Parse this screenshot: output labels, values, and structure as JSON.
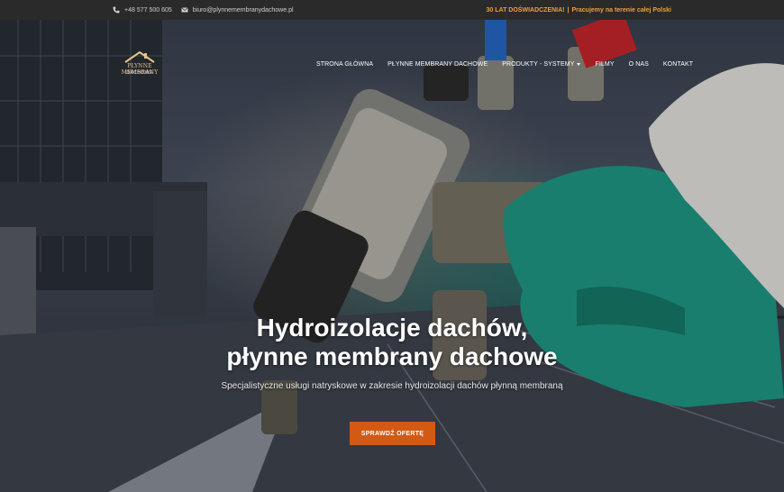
{
  "topbar": {
    "phone": "+48 577 500 605",
    "email": "biuro@plynnemembranydachowe.pl",
    "promo_highlight": "30 LAT DOŚWIADCZENIA!",
    "promo_sep": "|",
    "promo_rest": "Pracujemy na terenie całej Polski"
  },
  "logo": {
    "line1": "PŁYNNE MEMBRANY",
    "line2": "DACHOWE"
  },
  "nav": {
    "items": [
      {
        "label": "STRONA GŁÓWNA"
      },
      {
        "label": "PŁYNNE MEMBRANY DACHOWE"
      },
      {
        "label": "PRODUKTY - SYSTEMY"
      },
      {
        "label": "FILMY"
      },
      {
        "label": "O NAS"
      },
      {
        "label": "KONTAKT"
      }
    ]
  },
  "hero": {
    "title_line1": "Hydroizolacje dachów,",
    "title_line2": "płynne membrany dachowe",
    "subtitle": "Specjalistyczne usługi natryskowe w zakresie hydroizolacji dachów płynną membraną",
    "cta_label": "SPRAWDŹ OFERTĘ"
  },
  "colors": {
    "accent": "#e8a23a",
    "cta": "#d35a14",
    "topbar_bg": "#2a2a2a",
    "glove": "#1f9a86"
  },
  "icons": {
    "phone": "phone-icon",
    "email": "envelope-icon",
    "dropdown": "caret-down-icon"
  }
}
